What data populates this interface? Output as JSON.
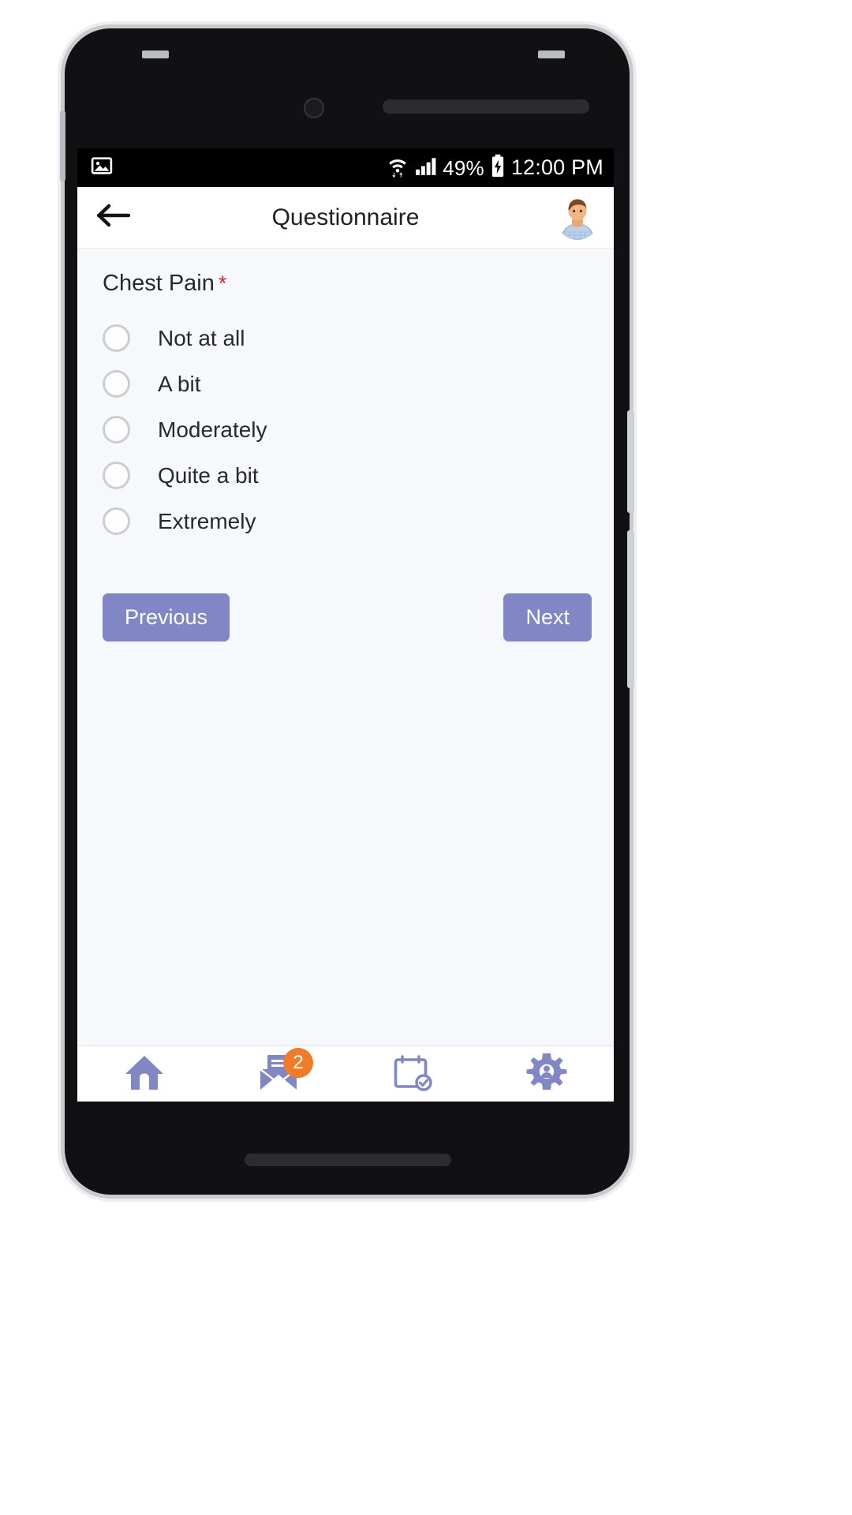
{
  "statusbar": {
    "left_icons": [
      "image-icon"
    ],
    "wifi_icon": "wifi-icon",
    "signal_icon": "signal-bars-icon",
    "battery_percent": "49%",
    "battery_icon": "battery-charging-icon",
    "time": "12:00 PM"
  },
  "appbar": {
    "back_icon": "back-arrow-icon",
    "title": "Questionnaire",
    "avatar_icon": "user-avatar"
  },
  "question": {
    "label": "Chest Pain",
    "required_marker": "*",
    "selected": null,
    "options": [
      {
        "label": "Not at all",
        "selected": false
      },
      {
        "label": "A bit",
        "selected": false
      },
      {
        "label": "Moderately",
        "selected": false
      },
      {
        "label": "Quite a bit",
        "selected": false
      },
      {
        "label": "Extremely",
        "selected": false
      }
    ]
  },
  "nav_buttons": {
    "previous_label": "Previous",
    "next_label": "Next"
  },
  "bottomnav": {
    "items": [
      {
        "icon": "home-icon",
        "badge": null
      },
      {
        "icon": "messages-icon",
        "badge": "2"
      },
      {
        "icon": "calendar-check-icon",
        "badge": null
      },
      {
        "icon": "settings-gear-icon",
        "badge": null
      }
    ]
  },
  "colors": {
    "accent_purple": "#8187c4",
    "badge_orange": "#f07c28",
    "required_red": "#e0242a",
    "content_bg": "#f6f8fb",
    "statusbar_bg": "#000000"
  }
}
